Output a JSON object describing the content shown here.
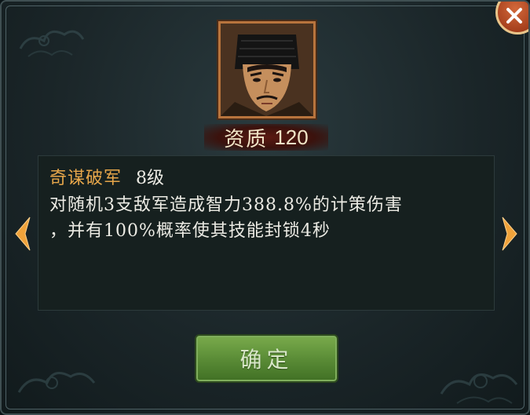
{
  "general": {
    "aptitude_label": "资质",
    "aptitude_value": "120"
  },
  "skill": {
    "name": "奇谋破军",
    "level": "8级",
    "description_line1": "对随机3支敌军造成智力388.8%的计策伤害",
    "description_line2": "，并有100%概率使其技能封锁4秒"
  },
  "buttons": {
    "confirm_label": "确定"
  },
  "icons": {
    "close": "close-icon",
    "prev": "arrow-left-icon",
    "next": "arrow-right-icon",
    "portrait": "general-portrait"
  },
  "colors": {
    "skill_name": "#e6a64a",
    "text": "#ecebe4",
    "confirm_green": "#5b8d37",
    "close_red": "#a53f1c",
    "arrow_orange": "#f0a23a"
  }
}
